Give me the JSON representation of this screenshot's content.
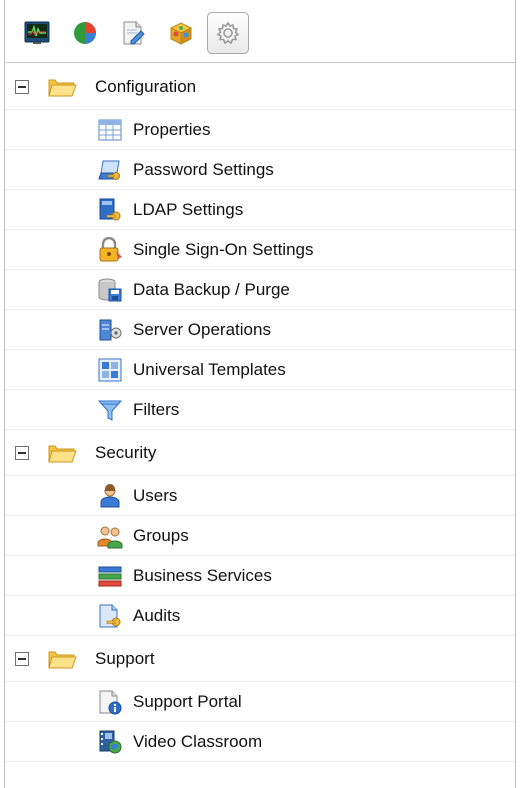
{
  "toolbar": {
    "buttons": [
      {
        "icon": "monitor-icon"
      },
      {
        "icon": "pie-chart-icon"
      },
      {
        "icon": "document-edit-icon"
      },
      {
        "icon": "package-icon"
      },
      {
        "icon": "gear-icon",
        "active": true
      }
    ]
  },
  "tree": {
    "configuration": {
      "label": "Configuration",
      "items": [
        "Properties",
        "Password Settings",
        "LDAP Settings",
        "Single Sign-On Settings",
        "Data Backup / Purge",
        "Server Operations",
        "Universal Templates",
        "Filters"
      ]
    },
    "security": {
      "label": "Security",
      "items": [
        "Users",
        "Groups",
        "Business Services",
        "Audits"
      ]
    },
    "support": {
      "label": "Support",
      "items": [
        "Support Portal",
        "Video Classroom"
      ]
    }
  },
  "colors": {
    "folder": "#f5c542",
    "folder_dark": "#d79b19",
    "accent_blue": "#3a7bd5"
  }
}
